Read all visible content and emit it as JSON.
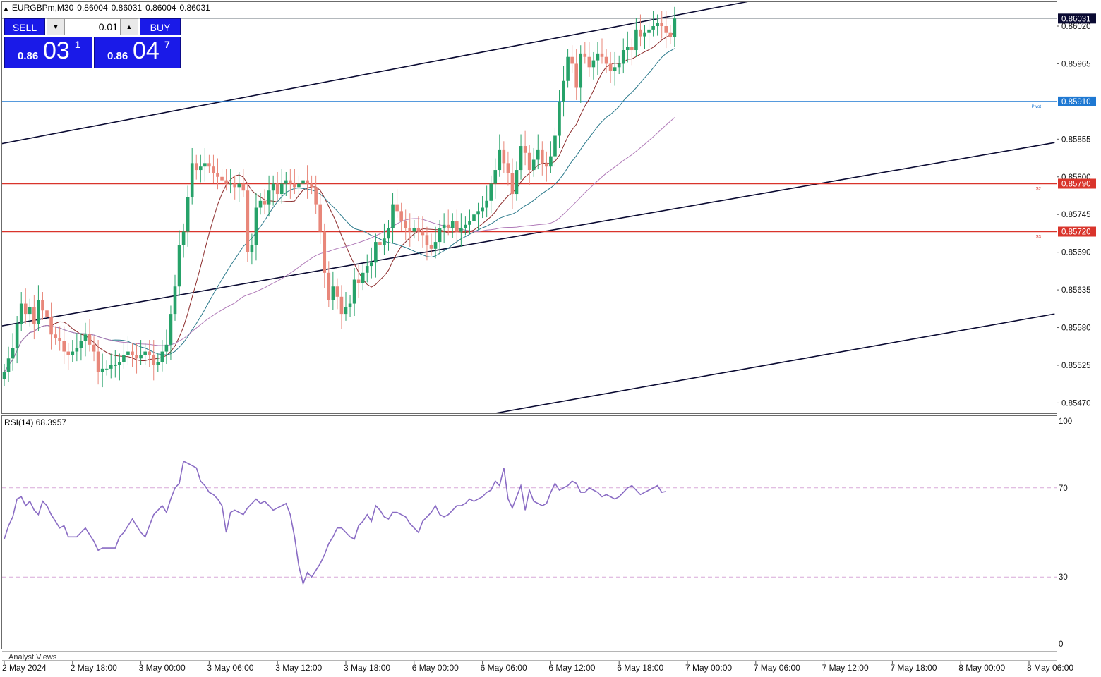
{
  "header": {
    "symbol": "EURGBPm,M30",
    "open": "0.86004",
    "high": "0.86031",
    "low": "0.86004",
    "close": "0.86031"
  },
  "trade_panel": {
    "sell_label": "SELL",
    "buy_label": "BUY",
    "lot": "0.01",
    "sell_prefix": "0.86",
    "sell_big": "03",
    "sell_sup": "1",
    "buy_prefix": "0.86",
    "buy_big": "04",
    "buy_sup": "7"
  },
  "rsi_title": "RSI(14) 68.3957",
  "footer_label": "Analyst Views",
  "colors": {
    "bull": "#26a269",
    "bear": "#e8877a",
    "trend": "#0a0a32",
    "pivot": "#1e78d2",
    "support": "#d9342b",
    "ma_fast": "#8b2a2a",
    "ma_mid": "#2c7a8c",
    "ma_slow": "#b07ab8",
    "rsi": "#8a6cc4",
    "price_tag": "#0a0a32"
  },
  "chart_data": [
    {
      "type": "candlestick",
      "title": "EURGBPm,M30",
      "x_ticks": [
        "2 May 2024",
        "2 May 18:00",
        "3 May 00:00",
        "3 May 06:00",
        "3 May 12:00",
        "3 May 18:00",
        "6 May 00:00",
        "6 May 06:00",
        "6 May 12:00",
        "6 May 18:00",
        "7 May 00:00",
        "7 May 06:00",
        "7 May 12:00",
        "7 May 18:00",
        "8 May 00:00",
        "8 May 06:00"
      ],
      "y_ticks": [
        "0.86020",
        "0.85965",
        "0.85855",
        "0.85800",
        "0.85745",
        "0.85690",
        "0.85635",
        "0.85580",
        "0.85525",
        "0.85470"
      ],
      "ylim": [
        0.85455,
        0.86055
      ],
      "last_price": "0.86031",
      "horizontal_levels": [
        {
          "name": "Pivot",
          "value": 0.8591,
          "label": "0.85910"
        },
        {
          "name": "S2",
          "value": 0.8579,
          "label": "0.85790"
        },
        {
          "name": "S3",
          "value": 0.8572,
          "label": "0.85720"
        }
      ],
      "closes": [
        0.85515,
        0.85535,
        0.8555,
        0.85585,
        0.85615,
        0.856,
        0.8561,
        0.85585,
        0.8562,
        0.85605,
        0.85595,
        0.8557,
        0.85565,
        0.8556,
        0.85545,
        0.8554,
        0.85545,
        0.8555,
        0.8556,
        0.8557,
        0.85555,
        0.85545,
        0.85515,
        0.8552,
        0.8552,
        0.85525,
        0.85525,
        0.8553,
        0.8554,
        0.85545,
        0.8554,
        0.85535,
        0.8554,
        0.85545,
        0.8554,
        0.85525,
        0.8553,
        0.85545,
        0.85555,
        0.856,
        0.8564,
        0.857,
        0.8572,
        0.8577,
        0.8582,
        0.8581,
        0.85815,
        0.8582,
        0.85815,
        0.85805,
        0.858,
        0.85795,
        0.8579,
        0.8579,
        0.85785,
        0.8579,
        0.8578,
        0.8569,
        0.857,
        0.85755,
        0.85765,
        0.8576,
        0.8578,
        0.8579,
        0.85775,
        0.8579,
        0.85795,
        0.8579,
        0.85785,
        0.8579,
        0.85795,
        0.8579,
        0.85785,
        0.8576,
        0.8572,
        0.8566,
        0.8562,
        0.8564,
        0.85625,
        0.856,
        0.8561,
        0.85615,
        0.8565,
        0.85645,
        0.8566,
        0.8567,
        0.85675,
        0.85705,
        0.857,
        0.8571,
        0.85725,
        0.8576,
        0.8575,
        0.85735,
        0.85725,
        0.8572,
        0.85725,
        0.8572,
        0.85715,
        0.857,
        0.85695,
        0.85705,
        0.85725,
        0.8573,
        0.85725,
        0.85735,
        0.8572,
        0.85725,
        0.8573,
        0.85735,
        0.85745,
        0.8575,
        0.85755,
        0.85765,
        0.8579,
        0.8581,
        0.8584,
        0.8582,
        0.85805,
        0.85775,
        0.8581,
        0.85845,
        0.85835,
        0.8581,
        0.85825,
        0.8584,
        0.8582,
        0.85815,
        0.8583,
        0.8586,
        0.8591,
        0.8594,
        0.85975,
        0.85965,
        0.8593,
        0.8598,
        0.85975,
        0.8596,
        0.8597,
        0.8598,
        0.85975,
        0.85965,
        0.85955,
        0.8596,
        0.85965,
        0.85985,
        0.8599,
        0.85985,
        0.86015,
        0.86005,
        0.8601,
        0.86015,
        0.8602,
        0.86025,
        0.8602,
        0.8601,
        0.86004,
        0.86031
      ],
      "series": [
        {
          "name": "RSI(14)",
          "pane": "rsi",
          "ylim": [
            0,
            100
          ],
          "y_ticks": [
            "100",
            "70",
            "30",
            "0"
          ],
          "levels": [
            70,
            30
          ],
          "values": [
            47,
            53,
            57,
            65,
            66,
            62,
            64,
            60,
            58,
            64,
            62,
            58,
            55,
            52,
            53,
            48,
            48,
            48,
            50,
            52,
            49,
            46,
            42,
            43,
            43,
            43,
            43,
            48,
            50,
            53,
            56,
            53,
            50,
            48,
            53,
            58,
            60,
            62,
            59,
            65,
            70,
            72,
            82,
            81,
            80,
            79,
            73,
            71,
            68,
            67,
            65,
            62,
            50,
            59,
            60,
            59,
            58,
            61,
            63,
            65,
            63,
            64,
            62,
            60,
            61,
            62,
            63,
            58,
            48,
            35,
            27,
            32,
            30,
            33,
            36,
            40,
            45,
            48,
            52,
            52,
            50,
            48,
            47,
            53,
            55,
            58,
            55,
            62,
            60,
            57,
            56,
            59,
            59,
            58,
            57,
            54,
            52,
            50,
            55,
            57,
            59,
            62,
            58,
            57,
            58,
            60,
            62,
            62,
            63,
            65,
            64,
            65,
            66,
            68,
            69,
            73,
            71,
            79,
            65,
            61,
            66,
            71,
            60,
            69,
            64,
            63,
            62,
            63,
            68,
            72,
            69,
            70,
            71,
            73,
            72,
            68,
            68,
            70,
            69,
            68,
            66,
            67,
            66,
            65,
            66,
            68,
            70,
            71,
            69,
            67,
            68,
            69,
            70,
            71,
            68,
            68.3957
          ]
        },
        {
          "name": "MA-fast",
          "pane": "price"
        },
        {
          "name": "MA-mid",
          "pane": "price"
        },
        {
          "name": "MA-slow",
          "pane": "price"
        }
      ]
    }
  ]
}
